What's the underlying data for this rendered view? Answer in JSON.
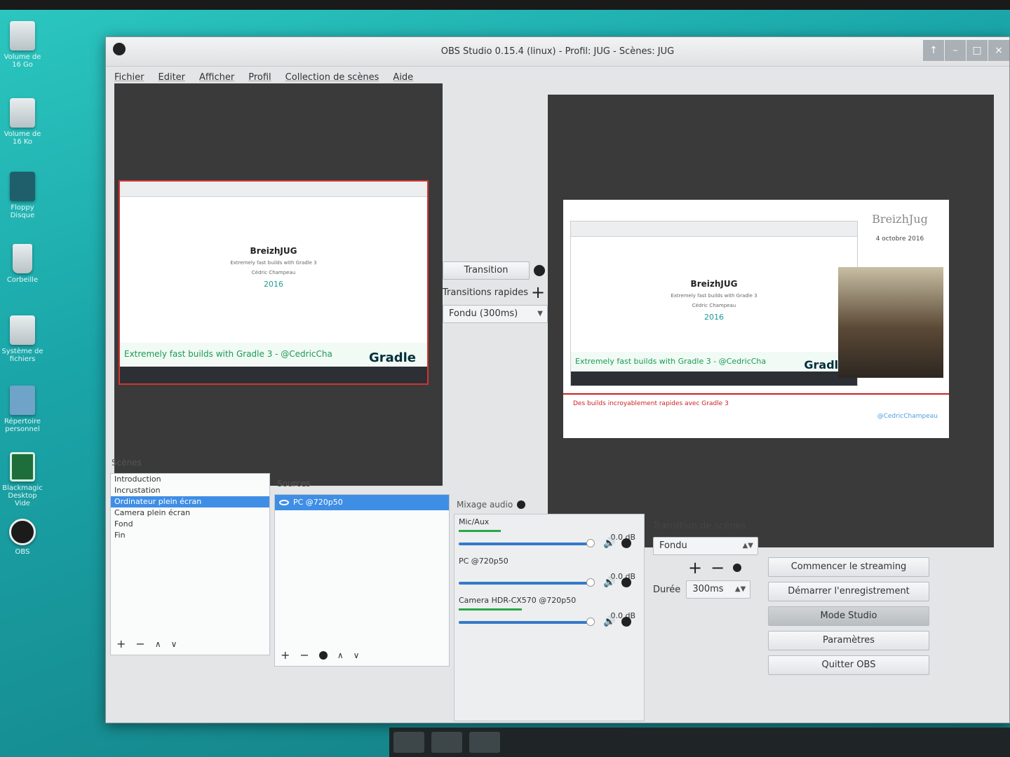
{
  "window": {
    "title": "OBS Studio 0.15.4 (linux) - Profil: JUG - Scènes: JUG",
    "controls": [
      "↑",
      "–",
      "□",
      "×"
    ]
  },
  "menu": [
    "Fichier",
    "Editer",
    "Afficher",
    "Profil",
    "Collection de scènes",
    "Aide"
  ],
  "desktop_icons": [
    "Volume de 16 Go",
    "Volume de 16 Ko",
    "Floppy Disque",
    "Corbeille",
    "Système de fichiers",
    "Répertoire personnel",
    "Blackmagic Desktop Vide",
    "OBS"
  ],
  "preview_left": {
    "slide_title": "BreizhJUG",
    "slide_sub": "Extremely fast builds with Gradle 3",
    "slide_author_name": "Cédric Champeau",
    "slide_year": "2016",
    "banner": "Extremely fast builds with Gradle 3 - @CedricCha",
    "gradle": "Gradle"
  },
  "preview_right": {
    "brand": "BreizhJug",
    "date": "4 octobre 2016",
    "slide_title": "BreizhJUG",
    "slide_sub": "Extremely fast builds with Gradle 3",
    "slide_author_name": "Cédric Champeau",
    "slide_year": "2016",
    "banner": "Extremely fast builds with Gradle 3 - @CedricCha",
    "gradle": "Gradle",
    "lower_third": "Des builds incroyablement rapides avec Gradle 3",
    "handle": "@CedricChampeau"
  },
  "transition": {
    "button": "Transition",
    "quick_label": "Transitions rapides",
    "select": "Fondu (300ms)"
  },
  "scenes": {
    "label": "Scènes",
    "items": [
      "Introduction",
      "Incrustation",
      "Ordinateur plein écran",
      "Camera plein écran",
      "Fond",
      "Fin"
    ],
    "selected": "Ordinateur plein écran"
  },
  "sources": {
    "label": "Sources",
    "items": [
      "PC @720p50"
    ]
  },
  "mixer": {
    "label": "Mixage audio",
    "channels": [
      {
        "name": "Mic/Aux",
        "db": "0.0 dB",
        "level": 0.3
      },
      {
        "name": "PC @720p50",
        "db": "0.0 dB",
        "level": 0
      },
      {
        "name": "Camera HDR-CX570 @720p50",
        "db": "0.0 dB",
        "level": 0.45
      }
    ]
  },
  "scene_transition": {
    "label": "Transition de scènes",
    "select": "Fondu",
    "duration_label": "Durée",
    "duration_value": "300ms"
  },
  "controls": {
    "start_stream": "Commencer le streaming",
    "start_record": "Démarrer l'enregistrement",
    "studio_mode": "Mode Studio",
    "settings": "Paramètres",
    "quit": "Quitter OBS"
  }
}
